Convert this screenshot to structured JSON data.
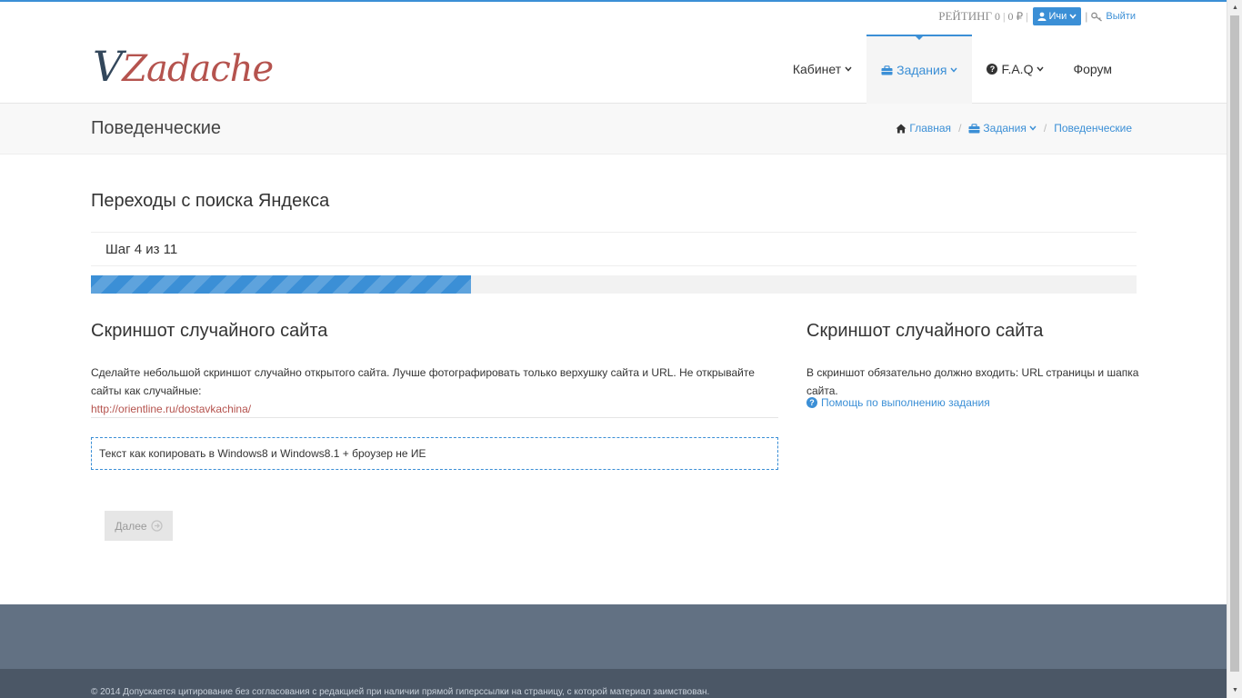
{
  "topbar": {
    "rating_label": "РЕЙТИНГ",
    "rating_value": "0",
    "balance": "0 ₽",
    "user_name": "Ичи",
    "logout_label": "Выйти"
  },
  "logo": {
    "first": "V",
    "rest": "Zadache"
  },
  "nav": {
    "cabinet": "Кабинет",
    "tasks": "Задания",
    "faq": "F.A.Q",
    "forum": "Форум"
  },
  "page": {
    "title": "Поведенческие",
    "breadcrumb": {
      "home": "Главная",
      "tasks": "Задания",
      "current": "Поведенческие"
    }
  },
  "task": {
    "title": "Переходы с поиска Яндекса",
    "step_text": "Шаг 4 из 11",
    "progress": {
      "current": 4,
      "total": 11
    }
  },
  "left": {
    "title": "Скриншот случайного сайта",
    "description": "Сделайте небольшой скриншот случайно открытого сайта. Лучше фотографировать только верхушку сайта и URL. Не открывайте сайты как случайные:",
    "link": "http://orientline.ru/dostavkachina/",
    "input_value": "Текст как копировать в Windows8 и Windows8.1 + броузер не ИЕ",
    "next_button": "Далее"
  },
  "right": {
    "title": "Скриншот случайного сайта",
    "description": "В скриншот обязательно должно входить: URL страницы и шапка сайта.",
    "help_link": "Помощь по выполнению задания"
  },
  "footer": {
    "copyright": "© 2014 Допускается цитирование без согласования с редакцией при наличии прямой гиперссылки на страницу, с которой материал заимствован."
  },
  "colors": {
    "accent": "#3b8fd6",
    "logo_red": "#b5534e",
    "logo_dark": "#33475b",
    "footer": "#627183"
  },
  "icons": [
    "user-icon",
    "key-icon",
    "briefcase-icon",
    "question-icon",
    "home-icon",
    "chevron-down-icon",
    "arrow-circle-right-icon"
  ]
}
